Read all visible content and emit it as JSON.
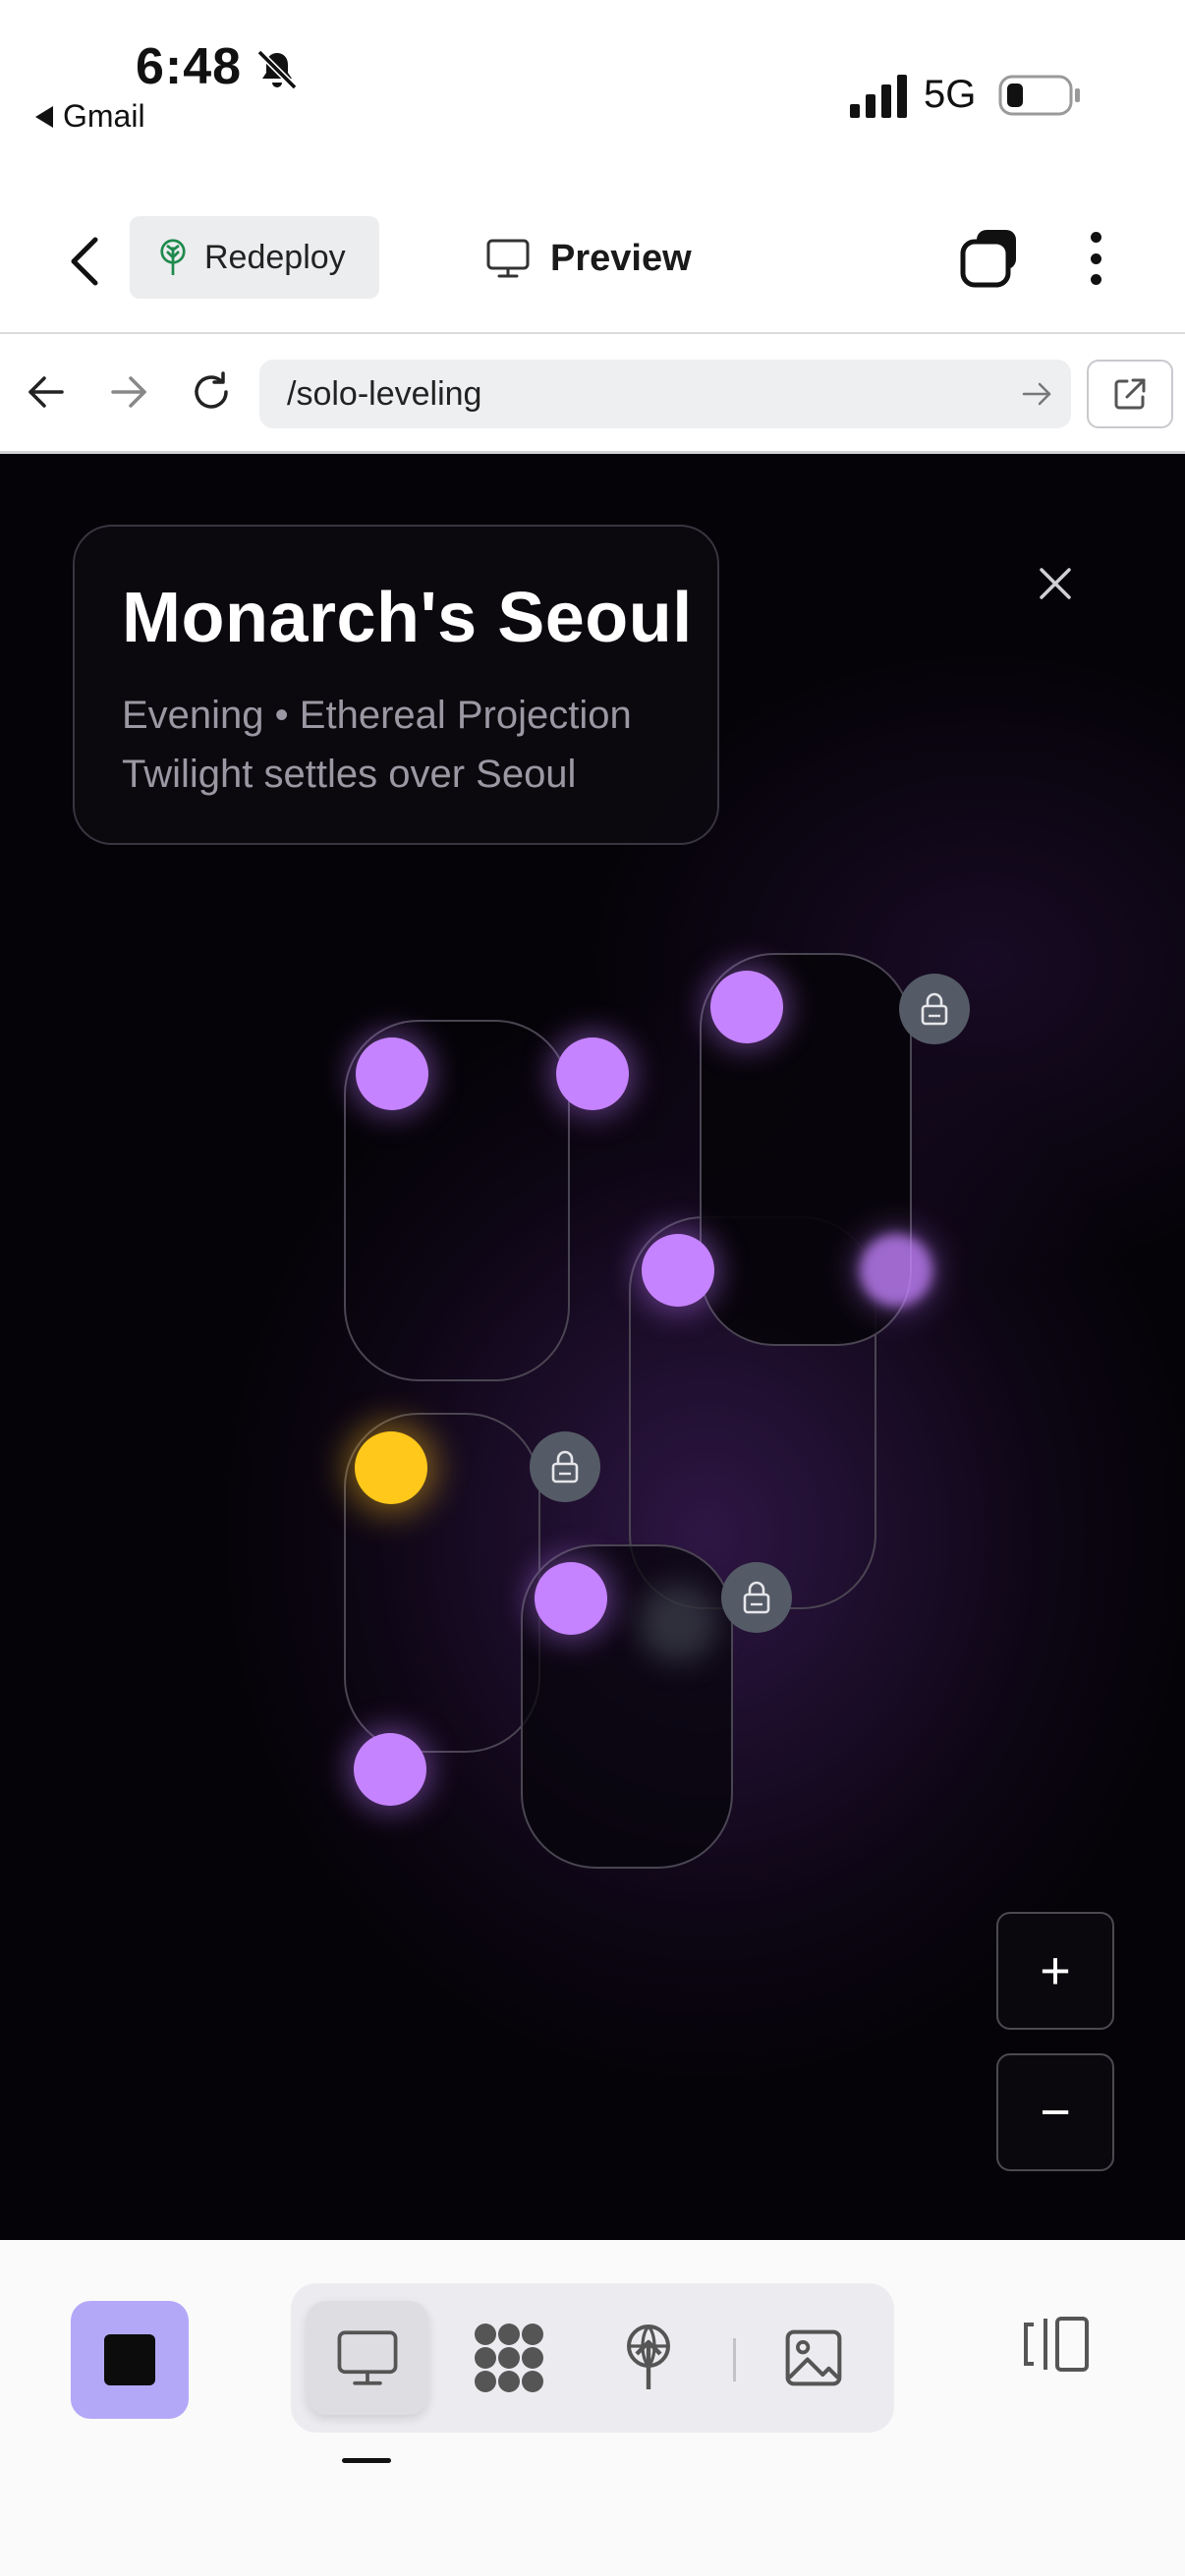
{
  "status": {
    "time": "6:48",
    "back_app": "Gmail",
    "network": "5G"
  },
  "toolbar": {
    "redeploy_label": "Redeploy",
    "preview_label": "Preview"
  },
  "browser": {
    "url": "/solo-leveling"
  },
  "scene": {
    "title": "Monarch's Seoul",
    "line1": "Evening • Ethereal Projection",
    "line2": "Twilight settles over Seoul",
    "zoom_in": "+",
    "zoom_out": "−"
  },
  "colors": {
    "orb": "#c583ff",
    "active_orb": "#ffc81a",
    "lock": "#545b66",
    "stop_button": "#b3a8f8"
  },
  "icons": {
    "bell_slash": "bell-slash-icon",
    "signal": "signal-icon",
    "battery": "battery-icon",
    "redeploy": "tree-icon",
    "preview": "monitor-icon",
    "windows": "windows-icon",
    "more": "more-vertical-icon",
    "nav": [
      "back-arrow-icon",
      "forward-arrow-icon",
      "reload-icon"
    ],
    "external": "external-link-icon",
    "bottom": [
      "monitor-icon",
      "dots-grid-icon",
      "deploy-icon",
      "image-icon",
      "panel-icon"
    ]
  }
}
